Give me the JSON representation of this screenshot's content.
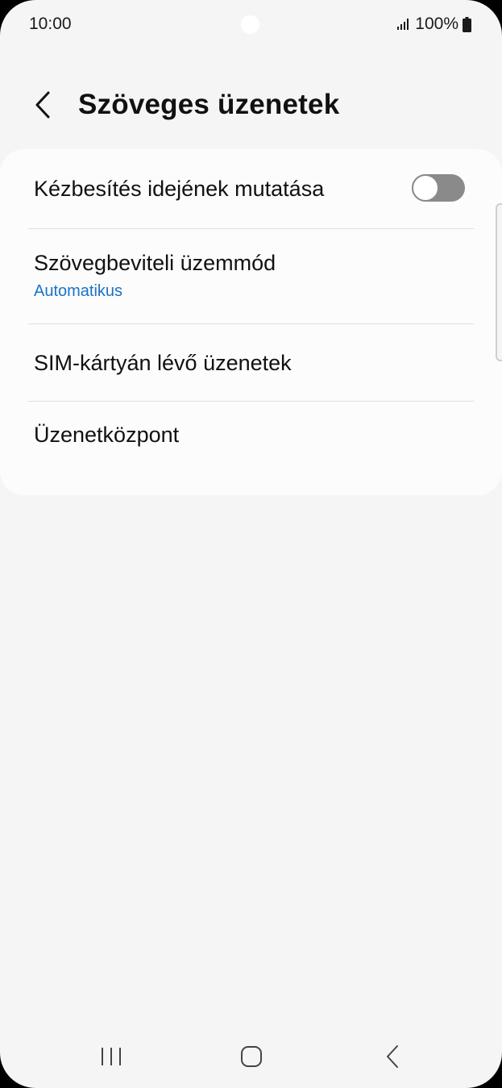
{
  "status_bar": {
    "time": "10:00",
    "battery_text": "100%",
    "icons": [
      "signal-icon",
      "battery-icon"
    ]
  },
  "header": {
    "title": "Szöveges üzenetek",
    "back_icon": "chevron-left-icon"
  },
  "settings": {
    "delivery_time": {
      "label": "Kézbesítés idejének mutatása",
      "toggle_on": false
    },
    "input_mode": {
      "label": "Szövegbeviteli üzemmód",
      "value": "Automatikus"
    },
    "sim_messages": {
      "label": "SIM-kártyán lévő üzenetek"
    },
    "message_center": {
      "label": "Üzenetközpont"
    }
  },
  "nav_bar": {
    "icons": [
      "recents-icon",
      "home-icon",
      "back-icon"
    ]
  },
  "colors": {
    "background": "#f5f5f5",
    "card": "#fcfcfc",
    "accent": "#1a73c4",
    "toggle_off": "#8a8a8a",
    "text": "#111111"
  }
}
